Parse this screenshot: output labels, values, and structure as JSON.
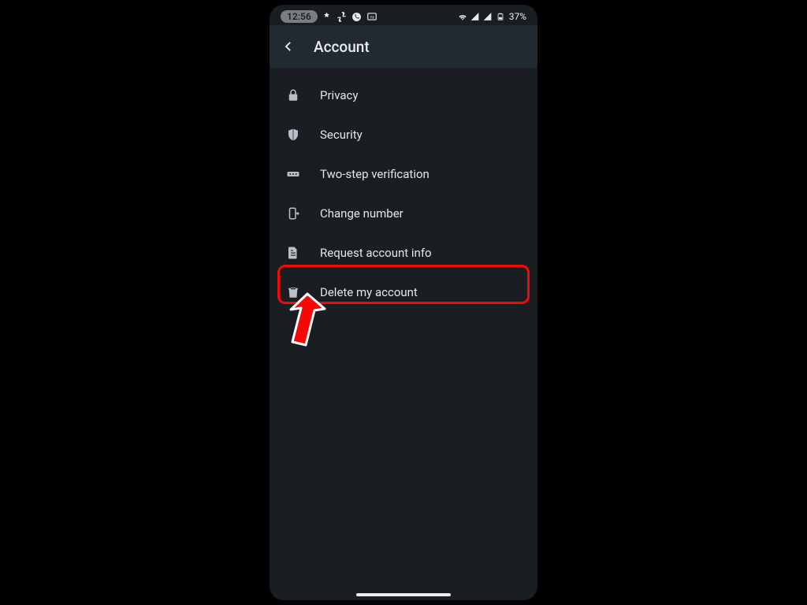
{
  "statusbar": {
    "time": "12:56",
    "battery": "37%"
  },
  "header": {
    "title": "Account"
  },
  "menu": {
    "items": [
      {
        "label": "Privacy"
      },
      {
        "label": "Security"
      },
      {
        "label": "Two-step verification"
      },
      {
        "label": "Change number"
      },
      {
        "label": "Request account info"
      },
      {
        "label": "Delete my account"
      }
    ]
  },
  "highlight": {
    "index": 5
  }
}
